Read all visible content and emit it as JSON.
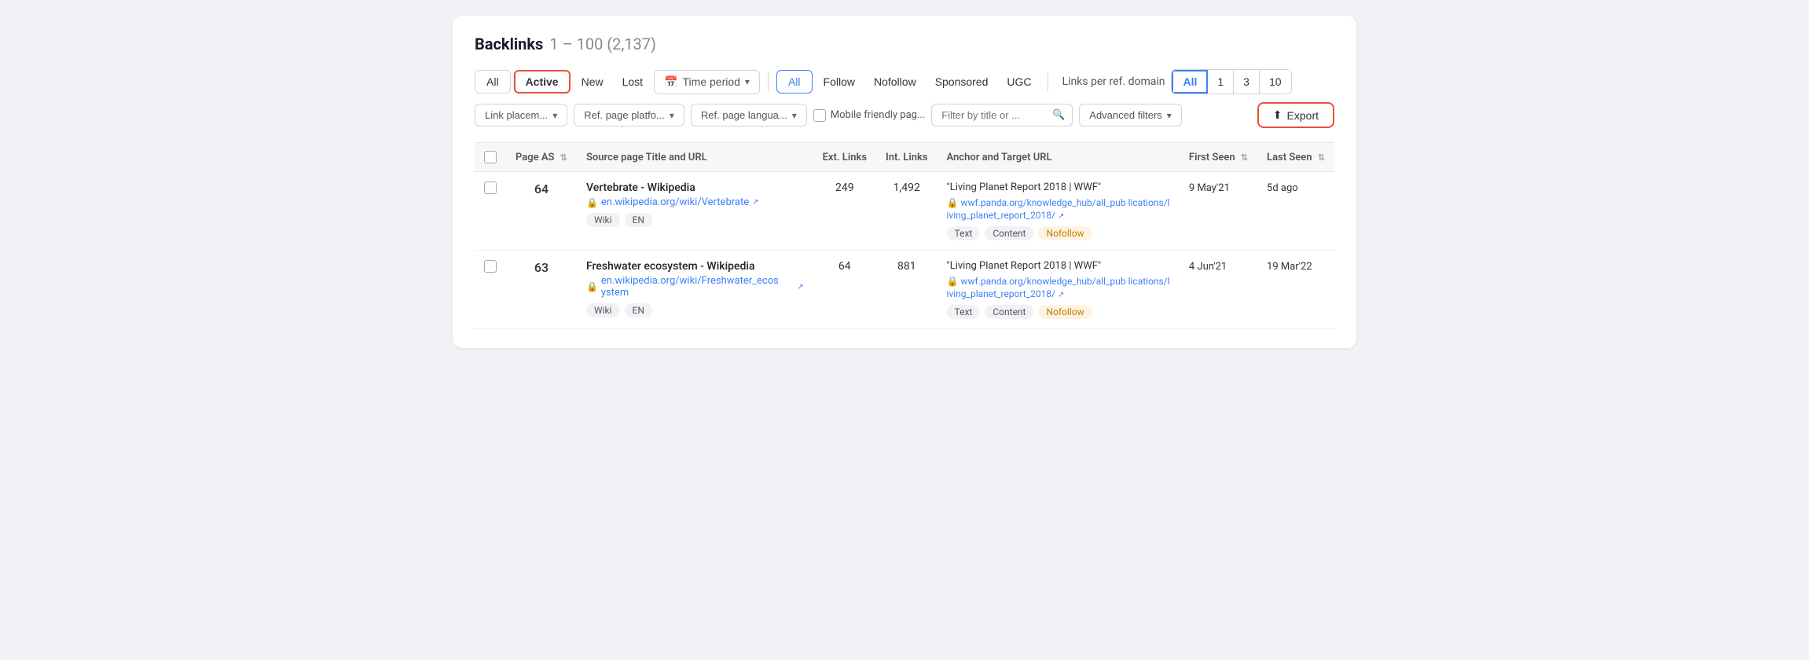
{
  "title": "Backlinks",
  "count_range": "1 – 100 (2,137)",
  "toolbar": {
    "status_filters": [
      {
        "id": "all",
        "label": "All",
        "active": false
      },
      {
        "id": "active",
        "label": "Active",
        "active": true
      },
      {
        "id": "new",
        "label": "New",
        "active": false
      },
      {
        "id": "lost",
        "label": "Lost",
        "active": false
      }
    ],
    "time_period_label": "Time period",
    "link_type_filters": [
      {
        "id": "all",
        "label": "All",
        "active": true
      },
      {
        "id": "follow",
        "label": "Follow",
        "active": false
      },
      {
        "id": "nofollow",
        "label": "Nofollow",
        "active": false
      },
      {
        "id": "sponsored",
        "label": "Sponsored",
        "active": false
      },
      {
        "id": "ugc",
        "label": "UGC",
        "active": false
      }
    ],
    "lprd_label": "Links per ref. domain",
    "lprd_buttons": [
      {
        "id": "all",
        "label": "All",
        "active": true
      },
      {
        "id": "1",
        "label": "1",
        "active": false
      },
      {
        "id": "3",
        "label": "3",
        "active": false
      },
      {
        "id": "10",
        "label": "10",
        "active": false
      }
    ]
  },
  "row2_filters": {
    "link_placement": "Link placem...",
    "ref_page_platform": "Ref. page platfo...",
    "ref_page_language": "Ref. page langua...",
    "mobile_friendly": "Mobile friendly pag...",
    "filter_title_placeholder": "Filter by title or ...",
    "advanced_filters": "Advanced filters",
    "export": "Export"
  },
  "table": {
    "columns": [
      {
        "id": "checkbox",
        "label": ""
      },
      {
        "id": "page_as",
        "label": "Page AS",
        "sortable": true
      },
      {
        "id": "source_title_url",
        "label": "Source page Title and URL"
      },
      {
        "id": "ext_links",
        "label": "Ext. Links"
      },
      {
        "id": "int_links",
        "label": "Int. Links"
      },
      {
        "id": "anchor_target",
        "label": "Anchor and Target URL"
      },
      {
        "id": "first_seen",
        "label": "First Seen",
        "sortable": true
      },
      {
        "id": "last_seen",
        "label": "Last Seen",
        "sortable": true
      }
    ],
    "rows": [
      {
        "page_as": "64",
        "source_title": "Vertebrate - Wikipedia",
        "source_url": "en.wikipedia.org/wiki/Vertebrate",
        "tags": [
          "Wiki",
          "EN"
        ],
        "ext_links": "249",
        "int_links": "1,492",
        "anchor_title": "\"Living Planet Report 2018 | WWF\"",
        "anchor_url": "wwf.panda.org/knowledge_hub/all_pub lications/living_planet_report_2018/",
        "anchor_tags": [
          "Text",
          "Content",
          "Nofollow"
        ],
        "first_seen": "9 May'21",
        "last_seen": "5d ago"
      },
      {
        "page_as": "63",
        "source_title": "Freshwater ecosystem - Wikipedia",
        "source_url": "en.wikipedia.org/wiki/Freshwater_ecos ystem",
        "tags": [
          "Wiki",
          "EN"
        ],
        "ext_links": "64",
        "int_links": "881",
        "anchor_title": "\"Living Planet Report 2018 | WWF\"",
        "anchor_url": "wwf.panda.org/knowledge_hub/all_pub lications/living_planet_report_2018/",
        "anchor_tags": [
          "Text",
          "Content",
          "Nofollow"
        ],
        "first_seen": "4 Jun'21",
        "last_seen": "19 Mar'22"
      }
    ]
  }
}
